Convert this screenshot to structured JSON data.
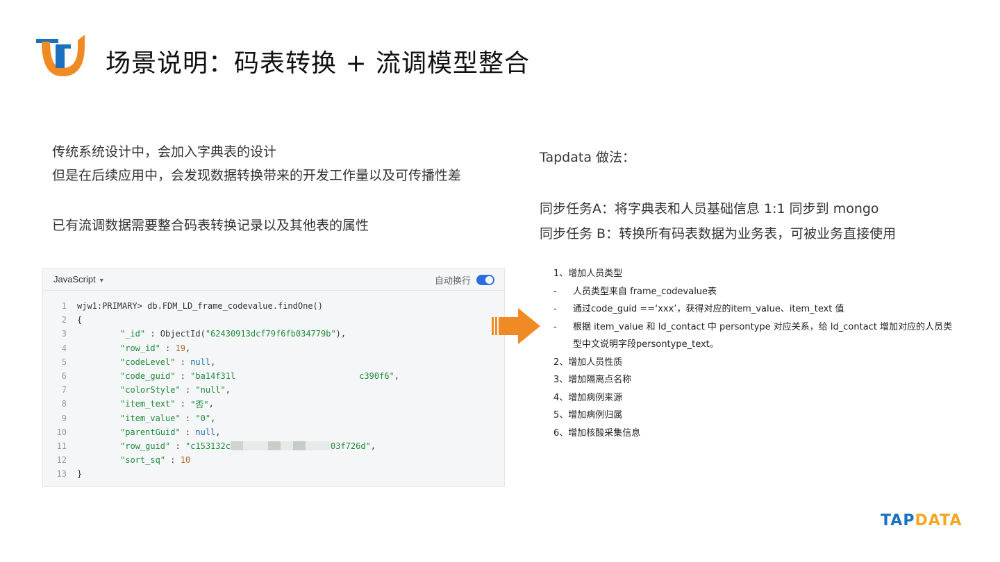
{
  "header": {
    "title": "场景说明：码表转换 + 流调模型整合"
  },
  "left": {
    "line1": "传统系统设计中，会加入字典表的设计",
    "line2": "但是在后续应用中，会发现数据转换带来的开发工作量以及可传播性差",
    "line3": "已有流调数据需要整合码表转换记录以及其他表的属性"
  },
  "code_panel": {
    "language": "JavaScript",
    "wrap_label": "自动换行",
    "wrap_enabled": true,
    "lines": [
      {
        "no": "1",
        "text": "wjw1:PRIMARY> db.FDM_LD_frame_codevalue.findOne()"
      },
      {
        "no": "2",
        "text": "{"
      },
      {
        "no": "3",
        "key": "\"_id\"",
        "sep": " : ObjectId(",
        "val": "\"62430913dcf79f6fb034779b\"",
        "tail": "),"
      },
      {
        "no": "4",
        "key": "\"row_id\"",
        "sep": " : ",
        "val": "19",
        "tail": ","
      },
      {
        "no": "5",
        "key": "\"codeLevel\"",
        "sep": " : ",
        "val": "null",
        "tail": ","
      },
      {
        "no": "6",
        "key": "\"code_guid\"",
        "sep": " : ",
        "val_a": "\"ba14f31l",
        "val_b": "c390f6\"",
        "tail": ","
      },
      {
        "no": "7",
        "key": "\"colorStyle\"",
        "sep": " : ",
        "val": "\"null\"",
        "tail": ","
      },
      {
        "no": "8",
        "key": "\"item_text\"",
        "sep": " : ",
        "val": "\"否\"",
        "tail": ","
      },
      {
        "no": "9",
        "key": "\"item_value\"",
        "sep": " : ",
        "val": "\"0\"",
        "tail": ","
      },
      {
        "no": "10",
        "key": "\"parentGuid\"",
        "sep": " : ",
        "val": "null",
        "tail": ","
      },
      {
        "no": "11",
        "key": "\"row_guid\"",
        "sep": " : ",
        "val_a": "\"c153132c",
        "val_b": "03f726d\"",
        "tail": ","
      },
      {
        "no": "12",
        "key": "\"sort_sq\"",
        "sep": " : ",
        "val": "10"
      },
      {
        "no": "13",
        "text": "}"
      }
    ]
  },
  "right": {
    "heading": "Tapdata 做法：",
    "task_a": "同步任务A：将字典表和人员基础信息 1:1 同步到 mongo",
    "task_b": "同步任务 B：转换所有码表数据为业务表，可被业务直接使用",
    "list": {
      "item1": "1、增加人员类型",
      "dash": "-",
      "sub1": "人员类型来自 frame_codevalue表",
      "sub2": "通过code_guid ==‘xxx’，获得对应的item_value、item_text 值",
      "sub3a": "根据 item_value 和 ld_contact 中 persontype 对应关系，给 ld_contact 增加对应的人员类",
      "sub3b": "型中文说明字段persontype_text。",
      "item2": "2、增加人员性质",
      "item3": "3、增加隔离点名称",
      "item4": "4、增加病例来源",
      "item5": "5、增加病例归属",
      "item6": "6、增加核酸采集信息"
    }
  },
  "brand": {
    "part1": "TAP",
    "part2": "DATA"
  },
  "colors": {
    "accent_orange": "#f08a24",
    "brand_blue": "#1a6fc0",
    "toggle_blue": "#2b6de0"
  }
}
